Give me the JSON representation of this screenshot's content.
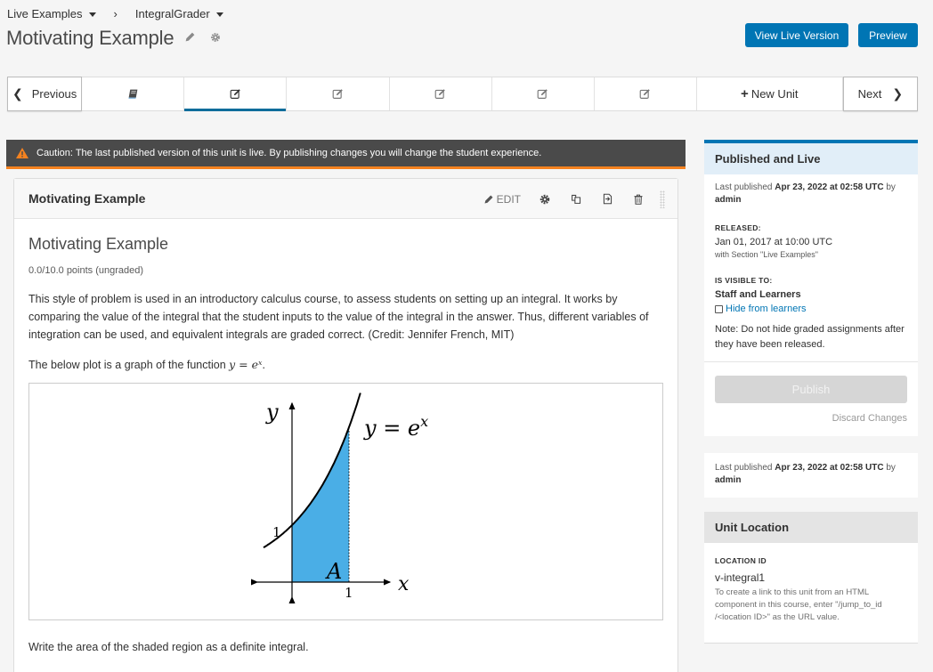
{
  "breadcrumb": {
    "course": "Live Examples",
    "separator": "›",
    "subsection": "IntegralGrader"
  },
  "page_title": "Motivating Example",
  "top_buttons": {
    "view_live": "View Live Version",
    "preview": "Preview"
  },
  "sequence_nav": {
    "previous": "Previous",
    "next": "Next",
    "new_unit": "New Unit",
    "tabs": [
      {
        "icon": "book-icon",
        "active": false
      },
      {
        "icon": "edit-icon",
        "active": true
      },
      {
        "icon": "edit-icon",
        "active": false
      },
      {
        "icon": "edit-icon",
        "active": false
      },
      {
        "icon": "edit-icon",
        "active": false
      }
    ]
  },
  "warning": {
    "text": "Caution: The last published version of this unit is live. By publishing changes you will change the student experience.",
    "color": "#f5821f"
  },
  "component": {
    "title": "Motivating Example",
    "edit_label": "EDIT",
    "problem": {
      "heading": "Motivating Example",
      "points": "0.0/10.0 points (ungraded)",
      "description": "This style of problem is used in an introductory calculus course, to assess students on setting up an integral. It works by comparing the value of the integral that the student inputs to the value of the integral in the answer. Thus, different variables of integration can be used, and equivalent integrals are graded correct. (Credit: Jennifer French, MIT)",
      "plot_intro": "The below plot is a graph of the function ",
      "plot_intro_math": "y = eˣ",
      "plot_intro_end": ".",
      "plot": {
        "y_label": "y",
        "x_label": "x",
        "curve_label": "y = e",
        "curve_label_exp": "x",
        "y_tick": "1",
        "x_tick": "1",
        "region_label": "A",
        "fill_color": "#4aaee6"
      },
      "prompt": "Write the area of the shaded region as a definite integral."
    }
  },
  "publish_panel": {
    "header": "Published and Live",
    "last_published_prefix": "Last published ",
    "last_published_date": "Apr 23, 2022 at 02:58 UTC",
    "last_published_by": " by",
    "last_published_user": "admin",
    "released_label": "RELEASED:",
    "released_date": "Jan 01, 2017 at 10:00 UTC",
    "released_with": "with Section \"Live Examples\"",
    "visible_label": "IS VISIBLE TO:",
    "visible_value": "Staff and Learners",
    "hide_label": "Hide from learners",
    "hide_checked": false,
    "note": "Note: Do not hide graded assignments after they have been released.",
    "publish_button": "Publish",
    "discard_button": "Discard Changes",
    "accent_color": "#0075b4"
  },
  "last_published_card": {
    "prefix": "Last published ",
    "date": "Apr 23, 2022 at 02:58 UTC",
    "by": " by",
    "user": "admin"
  },
  "unit_location": {
    "header": "Unit Location",
    "id_label": "LOCATION ID",
    "id_value": "v-integral1",
    "help": "To create a link to this unit from an HTML component in this course, enter \"/jump_to_id /<location ID>\" as the URL value."
  }
}
